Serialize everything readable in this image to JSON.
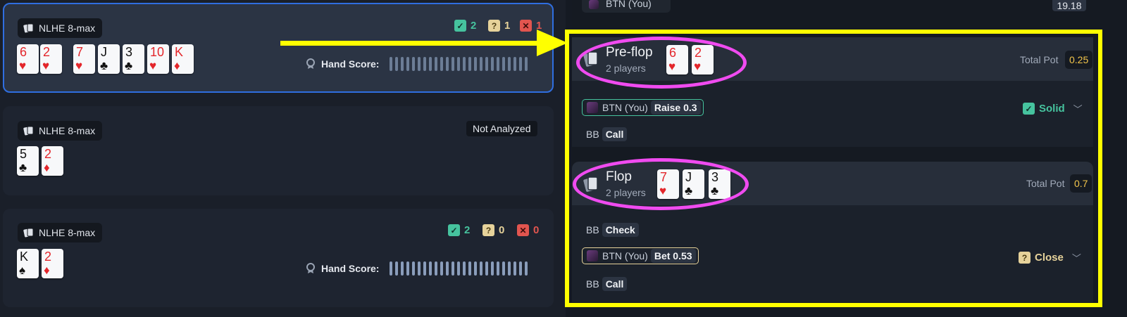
{
  "colors": {
    "accent_blue": "#2f6ee0",
    "good": "#46c39e",
    "question": "#e6d29a",
    "bad": "#e2554f",
    "pot": "#f2c54b",
    "highlight_yellow": "#ffff00",
    "highlight_magenta": "#f04bf0"
  },
  "hands": [
    {
      "format": "NLHE 8-max",
      "cards": [
        {
          "rank": "6",
          "suit": "♥"
        },
        {
          "rank": "2",
          "suit": "♥"
        },
        {
          "rank": "7",
          "suit": "♥"
        },
        {
          "rank": "J",
          "suit": "♣"
        },
        {
          "rank": "3",
          "suit": "♣"
        },
        {
          "rank": "10",
          "suit": "♥"
        },
        {
          "rank": "K",
          "suit": "♦"
        }
      ],
      "stats": {
        "good": "2",
        "question": "1",
        "bad": "1"
      },
      "score_label": "Hand Score:"
    },
    {
      "format": "NLHE 8-max",
      "cards": [
        {
          "rank": "5",
          "suit": "♣"
        },
        {
          "rank": "2",
          "suit": "♦"
        }
      ],
      "status": "Not Analyzed"
    },
    {
      "format": "NLHE 8-max",
      "cards": [
        {
          "rank": "K",
          "suit": "♠"
        },
        {
          "rank": "2",
          "suit": "♦"
        }
      ],
      "stats": {
        "good": "2",
        "question": "0",
        "bad": "0"
      },
      "score_label": "Hand Score:"
    }
  ],
  "top_row": {
    "player": "BTN (You)",
    "amount": "19.18"
  },
  "streets": [
    {
      "name": "Pre-flop",
      "players": "2 players",
      "cards": [
        {
          "rank": "6",
          "suit": "♥"
        },
        {
          "rank": "2",
          "suit": "♥"
        }
      ],
      "pot_label": "Total Pot",
      "pot": "0.25",
      "actions": [
        {
          "pos": "BTN (You)",
          "action": "Raise 0.3",
          "verdict": "Solid",
          "verdict_icon": "check-icon"
        },
        {
          "pos": "BB",
          "action": "Call"
        }
      ]
    },
    {
      "name": "Flop",
      "players": "2 players",
      "cards": [
        {
          "rank": "7",
          "suit": "♥"
        },
        {
          "rank": "J",
          "suit": "♣"
        },
        {
          "rank": "3",
          "suit": "♣"
        }
      ],
      "pot_label": "Total Pot",
      "pot": "0.7",
      "actions": [
        {
          "pos": "BB",
          "action": "Check"
        },
        {
          "pos": "BTN (You)",
          "action": "Bet 0.53",
          "verdict": "Close",
          "verdict_icon": "question-icon"
        },
        {
          "pos": "BB",
          "action": "Call"
        }
      ]
    }
  ]
}
